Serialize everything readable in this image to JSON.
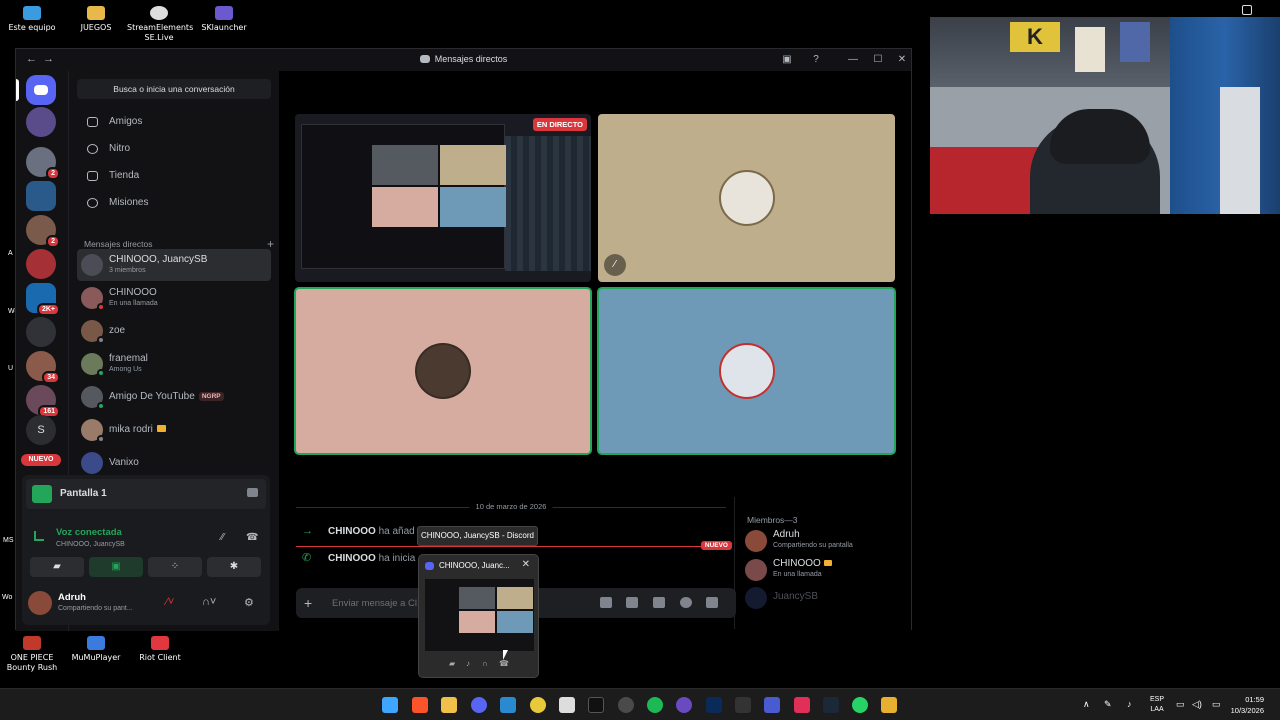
{
  "desktop": {
    "icons": [
      "Este equipo",
      "JUEGOS",
      "StreamElements SE.Live",
      "SKlauncher"
    ],
    "bottom_icons": [
      "ONE PIECE Bounty Rush",
      "MuMuPlayer",
      "Riot Client"
    ],
    "edge_labels": [
      "A",
      "Wo",
      "U",
      "MS",
      "Wo"
    ]
  },
  "window": {
    "title": "Mensajes directos"
  },
  "rail": {
    "badges": [
      "2",
      "2",
      "2K+",
      "34",
      "161"
    ],
    "s_label": "S",
    "new_label": "NUEVO"
  },
  "dm_column": {
    "search_label": "Busca o inicia una conversación",
    "nav": [
      "Amigos",
      "Nitro",
      "Tienda",
      "Misiones"
    ],
    "section_title": "Mensajes directos",
    "dms": [
      {
        "name": "CHINOOO, JuancySB",
        "sub": "3 miembros"
      },
      {
        "name": "CHINOOO",
        "sub": "En una llamada"
      },
      {
        "name": "zoe",
        "sub": ""
      },
      {
        "name": "franemal",
        "sub": "Among Us"
      },
      {
        "name": "Amigo De YouTube",
        "sub": "",
        "tag": "NGRP"
      },
      {
        "name": "mika rodri",
        "sub": ""
      },
      {
        "name": "Vanixo",
        "sub": ""
      }
    ]
  },
  "voice_panel": {
    "screen_label": "Pantalla 1",
    "status": "Voz conectada",
    "channel": "CHINOOO, JuancySB",
    "user_name": "Adruh",
    "user_status": "Compartiendo su pant..."
  },
  "call": {
    "live_badge": "EN DIRECTO",
    "colors": {
      "tile2": "#bfae8c",
      "tile3": "#d7aca0",
      "tile4": "#6e9ab7",
      "speaking": "#23a55a"
    }
  },
  "chat": {
    "date": "10 de marzo de 2026",
    "messages": [
      {
        "user": "CHINOOO",
        "text": "ha añad"
      },
      {
        "user": "CHINOOO",
        "text": "ha inicia"
      }
    ],
    "new_badge": "NUEVO",
    "composer_placeholder": "Enviar mensaje a Cl"
  },
  "members": {
    "header": "Miembros—3",
    "list": [
      {
        "name": "Adruh",
        "status": "Compartiendo su pantalla"
      },
      {
        "name": "CHINOOO",
        "status": "En una llamada"
      },
      {
        "name": "JuancySB",
        "status": ""
      }
    ]
  },
  "tooltip": {
    "text": "CHINOOO, JuancySB - Discord"
  },
  "preview": {
    "title": "CHINOOO, Juanc..."
  },
  "taskbar": {
    "lang_top": "ESP",
    "lang_bottom": "LAA",
    "time": "01:59",
    "date": "10/3/2026"
  }
}
